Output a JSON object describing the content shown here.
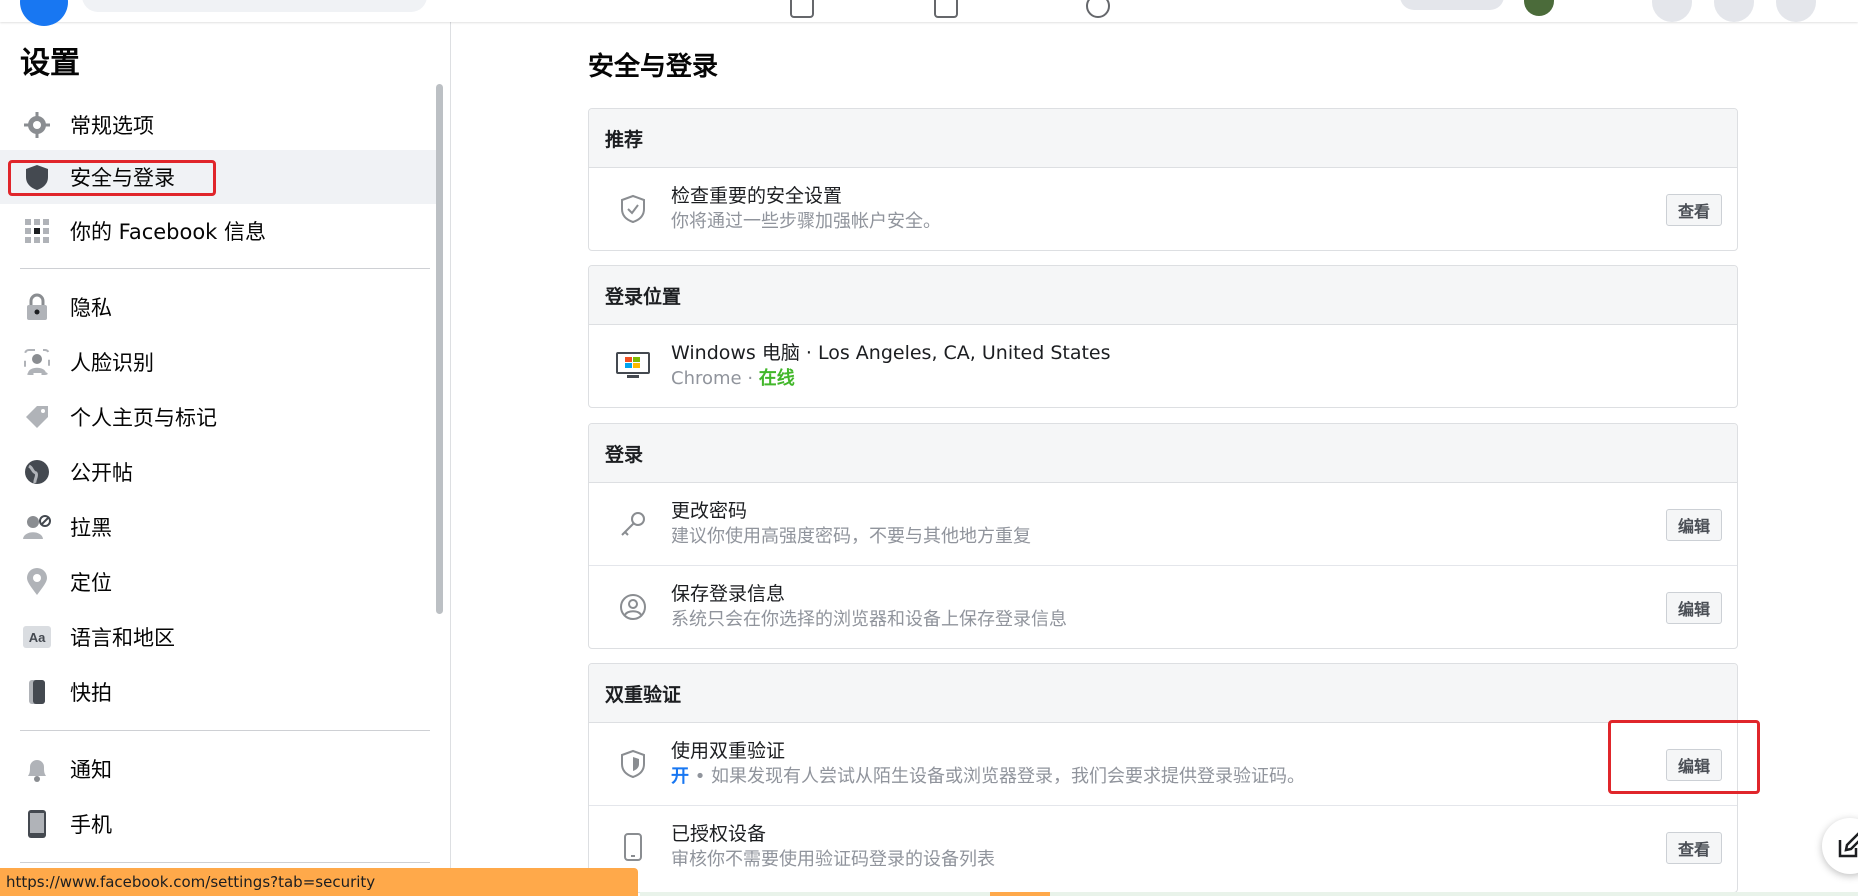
{
  "sidebar": {
    "title": "设置",
    "items": [
      {
        "label": "常规选项",
        "icon": "gear-icon"
      },
      {
        "label": "安全与登录",
        "icon": "shield-icon"
      },
      {
        "label": "你的 Facebook 信息",
        "icon": "grid-icon"
      },
      {
        "label": "隐私",
        "icon": "lock-icon"
      },
      {
        "label": "人脸识别",
        "icon": "face-icon"
      },
      {
        "label": "个人主页与标记",
        "icon": "tag-icon"
      },
      {
        "label": "公开帖",
        "icon": "globe-icon"
      },
      {
        "label": "拉黑",
        "icon": "block-user-icon"
      },
      {
        "label": "定位",
        "icon": "location-pin-icon"
      },
      {
        "label": "语言和地区",
        "icon": "language-icon"
      },
      {
        "label": "快拍",
        "icon": "story-icon"
      },
      {
        "label": "通知",
        "icon": "bell-icon"
      },
      {
        "label": "手机",
        "icon": "phone-icon"
      }
    ],
    "active_index": 1
  },
  "main": {
    "title": "安全与登录",
    "sections": {
      "recommended": {
        "header": "推荐",
        "rows": [
          {
            "title": "检查重要的安全设置",
            "subtitle": "你将通过一些步骤加强帐户安全。",
            "button": "查看",
            "icon": "shield-check-icon"
          }
        ]
      },
      "login_location": {
        "header": "登录位置",
        "rows": [
          {
            "title": "Windows 电脑 · Los Angeles, CA, United States",
            "subtitle_prefix": "Chrome · ",
            "status": "在线",
            "icon": "windows-computer-icon"
          }
        ]
      },
      "login": {
        "header": "登录",
        "rows": [
          {
            "title": "更改密码",
            "subtitle": "建议你使用高强度密码，不要与其他地方重复",
            "button": "编辑",
            "icon": "key-icon"
          },
          {
            "title": "保存登录信息",
            "subtitle": "系统只会在你选择的浏览器和设备上保存登录信息",
            "button": "编辑",
            "icon": "user-circle-icon"
          }
        ]
      },
      "two_factor": {
        "header": "双重验证",
        "rows": [
          {
            "title": "使用双重验证",
            "status": "开",
            "subtitle": " • 如果发现有人尝试从陌生设备或浏览器登录，我们会要求提供登录验证码。",
            "button": "编辑",
            "icon": "shield-icon"
          },
          {
            "title": "已授权设备",
            "subtitle": "审核你不需要使用验证码登录的设备列表",
            "button": "查看",
            "icon": "mobile-device-icon"
          }
        ]
      }
    }
  },
  "statusbar": {
    "url": "https://www.facebook.com/settings?tab=security"
  },
  "colors": {
    "accent": "#1877f2",
    "online": "#42b72a",
    "highlight": "#e0262b",
    "statusbar": "#ffa94a"
  }
}
